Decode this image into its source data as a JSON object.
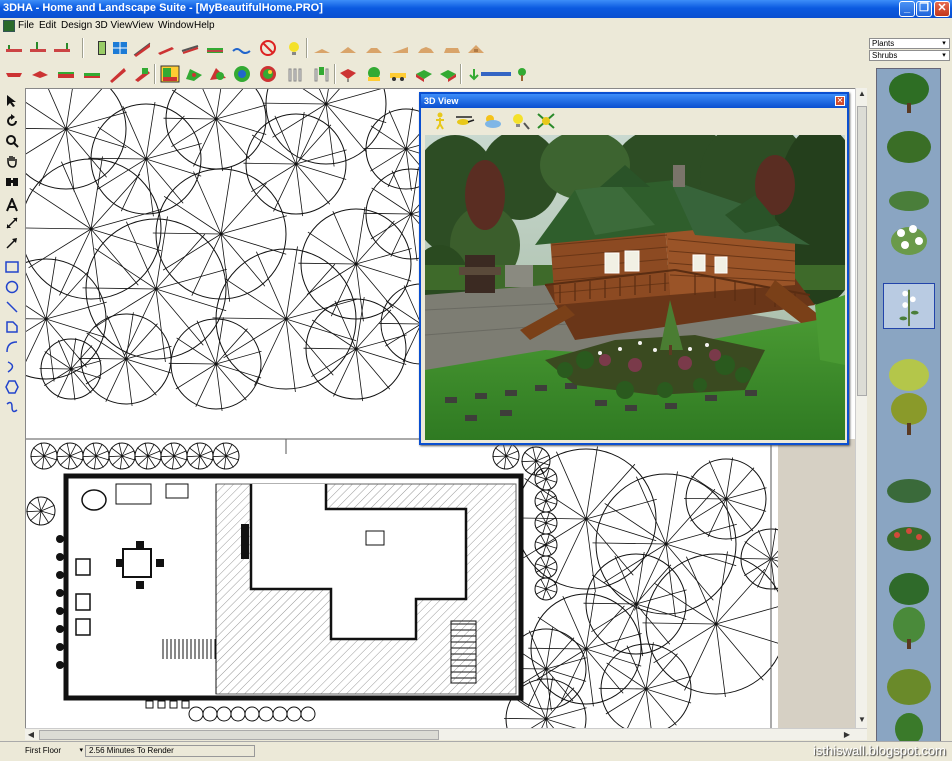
{
  "window": {
    "title": "3DHA - Home and Landscape Suite - [MyBeautifulHome.PRO]",
    "minimize_glyph": "_",
    "restore_glyph": "❐",
    "close_glyph": "✕"
  },
  "menu": {
    "items": [
      "File",
      "Edit",
      "Design",
      "3D View",
      "View",
      "Window",
      "Help"
    ]
  },
  "library": {
    "category": "Plants",
    "subcategory": "Shrubs",
    "dropdown_arrow": "▾"
  },
  "view3d": {
    "title": "3D View",
    "close_glyph": "✕"
  },
  "status": {
    "floor": "First Floor",
    "floor_arrow": "▾",
    "render_time": "2.56 Minutes To Render",
    "watermark": "isthiswall.blogspot.com"
  },
  "colors": {
    "title_bar": "#0a4fd0",
    "chrome": "#ece9d8",
    "canvas": "#ffffff",
    "plant_strip": "#8aa5c2",
    "lawn": "#3f8a2a",
    "roof": "#3c6b3a",
    "wood": "#8a4a22"
  },
  "icons": {
    "left_tools": [
      "pointer-icon",
      "rotate-icon",
      "zoom-icon",
      "pan-hand-icon",
      "binoculars-icon",
      "text-icon",
      "dimension-icon",
      "arrow-icon",
      "rectangle-icon",
      "circle-icon",
      "line-icon",
      "polygon-icon",
      "arc-icon",
      "curve-icon",
      "hexagon-icon",
      "spline-icon"
    ]
  }
}
